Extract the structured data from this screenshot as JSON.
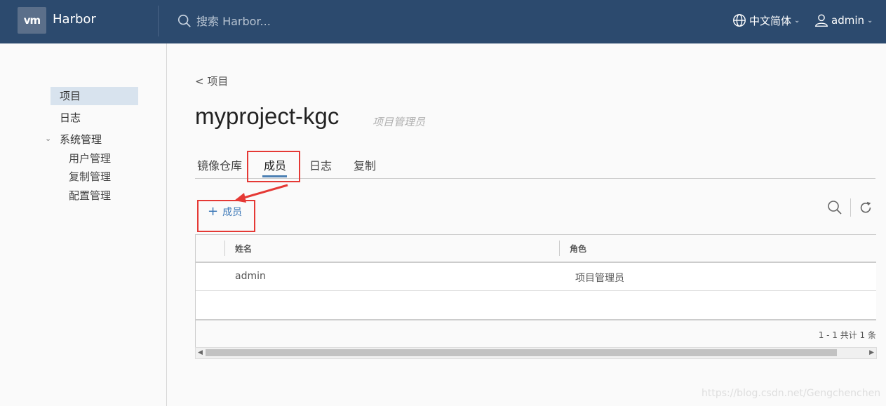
{
  "header": {
    "logo_text": "vm",
    "app_title": "Harbor",
    "search_placeholder": "搜索 Harbor...",
    "language": "中文简体",
    "user": "admin",
    "colors": {
      "bar": "#2c4a6e",
      "accent": "#4b7fb3"
    }
  },
  "sidebar": {
    "items": [
      {
        "label": "项目",
        "active": true
      },
      {
        "label": "日志"
      }
    ],
    "group": {
      "label": "系统管理",
      "children": [
        "用户管理",
        "复制管理",
        "配置管理"
      ]
    }
  },
  "main": {
    "breadcrumb": "< 项目",
    "title": "myproject-kgc",
    "role_subtitle": "项目管理员",
    "tabs": [
      "镜像仓库",
      "成员",
      "日志",
      "复制"
    ],
    "active_tab": "成员",
    "add_member_label": "成员",
    "table": {
      "columns": [
        "姓名",
        "角色"
      ],
      "rows": [
        {
          "name": "admin",
          "role": "项目管理员"
        }
      ],
      "footer": "1 - 1 共计 1 条"
    }
  },
  "watermark": "https://blog.csdn.net/Gengchenchen"
}
